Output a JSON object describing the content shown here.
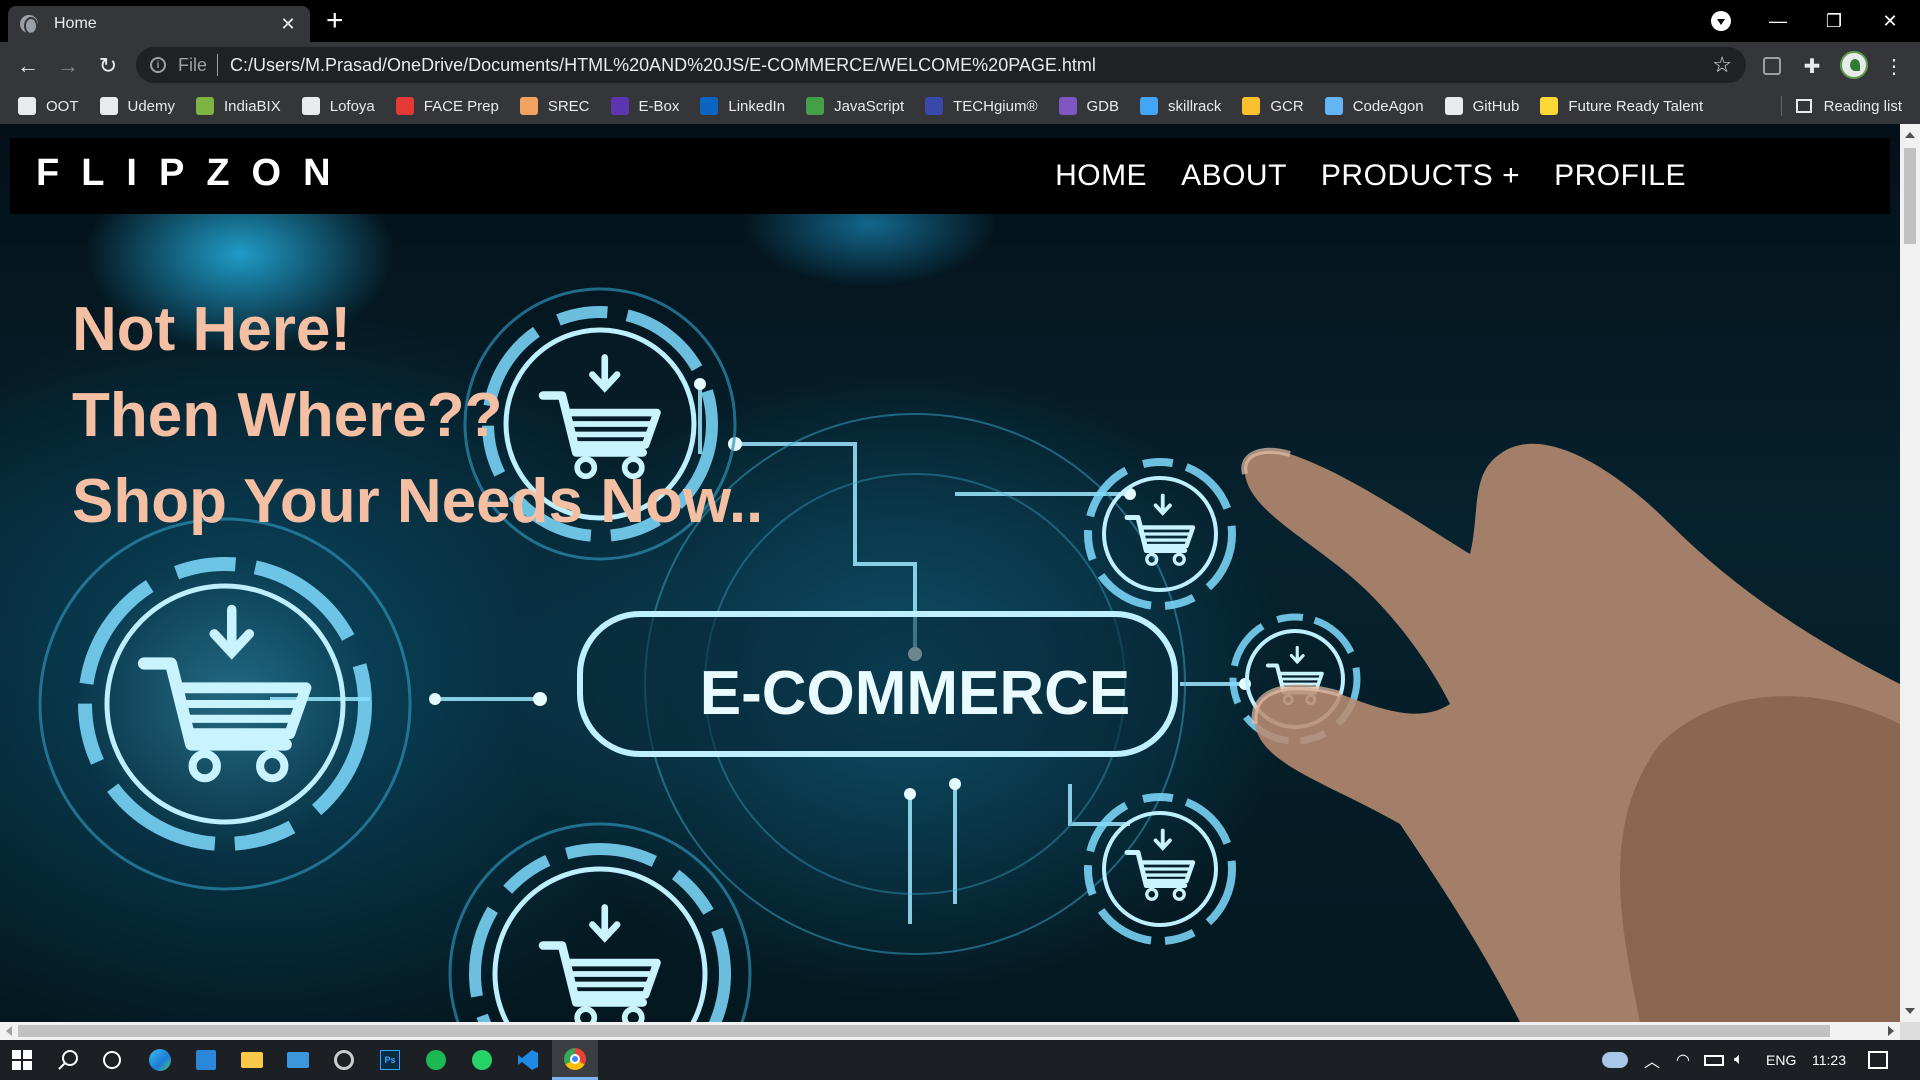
{
  "browser": {
    "tab_title": "Home",
    "address_scheme": "File",
    "address_url": "C:/Users/M.Prasad/OneDrive/Documents/HTML%20AND%20JS/E-COMMERCE/WELCOME%20PAGE.html",
    "reading_list_label": "Reading list"
  },
  "bookmarks": [
    {
      "label": "OOT",
      "color": "#e8eaed"
    },
    {
      "label": "Udemy",
      "color": "#e8eaed"
    },
    {
      "label": "IndiaBIX",
      "color": "#7cb342"
    },
    {
      "label": "Lofoya",
      "color": "#e8eaed"
    },
    {
      "label": "FACE Prep",
      "color": "#e53935"
    },
    {
      "label": "SREC",
      "color": "#f4a261"
    },
    {
      "label": "E-Box",
      "color": "#5e35b1"
    },
    {
      "label": "LinkedIn",
      "color": "#0a66c2"
    },
    {
      "label": "JavaScript",
      "color": "#43a047"
    },
    {
      "label": "TECHgium®",
      "color": "#3949ab"
    },
    {
      "label": "GDB",
      "color": "#7e57c2"
    },
    {
      "label": "skillrack",
      "color": "#42a5f5"
    },
    {
      "label": "GCR",
      "color": "#fbc02d"
    },
    {
      "label": "CodeAgon",
      "color": "#64b5f6"
    },
    {
      "label": "GitHub",
      "color": "#e8eaed"
    },
    {
      "label": "Future Ready Talent",
      "color": "#fdd835"
    }
  ],
  "site": {
    "logo": "FLIPZON",
    "nav": [
      "HOME",
      "ABOUT",
      "PRODUCTS +",
      "PROFILE"
    ],
    "headline": [
      "Not Here!",
      "Then Where??",
      "Shop Your Needs Now.."
    ],
    "hero_badge": "E-COMMERCE",
    "accent_color": "#f4bfa2"
  },
  "taskbar": {
    "language": "ENG",
    "time": "11:23"
  }
}
